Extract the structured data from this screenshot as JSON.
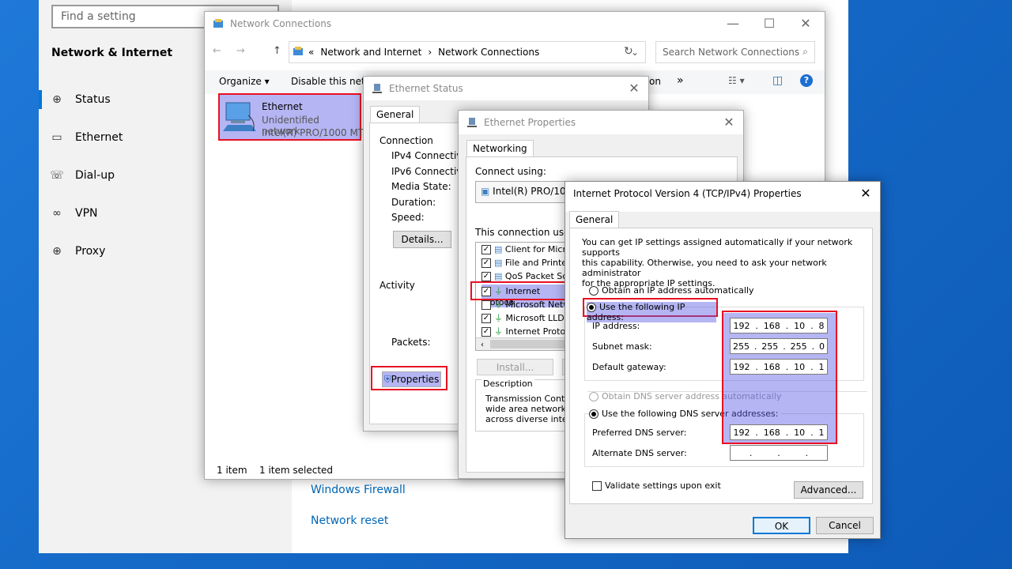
{
  "settings": {
    "search_placeholder": "Find a setting",
    "section_title": "Network & Internet",
    "nav": [
      {
        "label": "Status",
        "icon": "globe-icon"
      },
      {
        "label": "Ethernet",
        "icon": "ethernet-icon"
      },
      {
        "label": "Dial-up",
        "icon": "phone-icon"
      },
      {
        "label": "VPN",
        "icon": "vpn-icon"
      },
      {
        "label": "Proxy",
        "icon": "globe-icon"
      }
    ],
    "links": {
      "firewall": "Windows Firewall",
      "reset": "Network reset"
    }
  },
  "netcon": {
    "title": "Network Connections",
    "breadcrumb": [
      "«",
      "Network and Internet",
      "Network Connections"
    ],
    "search_placeholder": "Search Network Connections",
    "cmd": {
      "organize": "Organize",
      "disable": "Disable this netw",
      "more": "on",
      "chev": "»"
    },
    "adapter": {
      "name": "Ethernet",
      "status": "Unidentified network",
      "device": "Intel(R) PRO/1000 MT De"
    },
    "statusbar": {
      "count": "1 item",
      "selected": "1 item selected"
    }
  },
  "ethstatus": {
    "title": "Ethernet Status",
    "tab": "General",
    "connection_label": "Connection",
    "rows": [
      "IPv4 Connectivity",
      "IPv6 Connectivity",
      "Media State:",
      "Duration:",
      "Speed:"
    ],
    "details_button": "Details...",
    "activity_label": "Activity",
    "packets_label": "Packets:",
    "properties_button": "Properties"
  },
  "ethprops": {
    "title": "Ethernet Properties",
    "tab": "Networking",
    "connect_using_label": "Connect using:",
    "adapter": "Intel(R) PRO/1000",
    "uses_label": "This connection uses th",
    "items": [
      {
        "label": "Client for Micros",
        "checked": true
      },
      {
        "label": "File and Printer",
        "checked": true
      },
      {
        "label": "QoS Packet Sc",
        "checked": true
      },
      {
        "label": "Internet Protoco",
        "checked": true
      },
      {
        "label": "Microsoft Netw",
        "checked": false
      },
      {
        "label": "Microsoft LLDP",
        "checked": true
      },
      {
        "label": "Internet Protoco",
        "checked": true
      }
    ],
    "install_button": "Install...",
    "description_label": "Description",
    "description_text": [
      "Transmission Control",
      "wide area network pro",
      "across diverse interco"
    ]
  },
  "ipv4": {
    "title": "Internet Protocol Version 4 (TCP/IPv4) Properties",
    "tab": "General",
    "intro": [
      "You can get IP settings assigned automatically if your network supports",
      "this capability. Otherwise, you need to ask your network administrator",
      "for the appropriate IP settings."
    ],
    "auto_ip": "Obtain an IP address automatically",
    "manual_ip": "Use the following IP address:",
    "ip_label": "IP address:",
    "mask_label": "Subnet mask:",
    "gateway_label": "Default gateway:",
    "ip": [
      "192",
      "168",
      "10",
      "8"
    ],
    "mask": [
      "255",
      "255",
      "255",
      "0"
    ],
    "gateway": [
      "192",
      "168",
      "10",
      "1"
    ],
    "auto_dns": "Obtain DNS server address automatically",
    "manual_dns": "Use the following DNS server addresses:",
    "pref_dns_label": "Preferred DNS server:",
    "alt_dns_label": "Alternate DNS server:",
    "pref_dns": [
      "192",
      "168",
      "10",
      "1"
    ],
    "alt_dns": [
      "",
      "",
      "",
      ""
    ],
    "validate": "Validate settings upon exit",
    "advanced_button": "Advanced...",
    "ok_button": "OK",
    "cancel_button": "Cancel"
  },
  "colors": {
    "highlight": "#5a5ae6",
    "annotation": "#e81123",
    "accent": "#0078d7",
    "link": "#0067b8"
  }
}
